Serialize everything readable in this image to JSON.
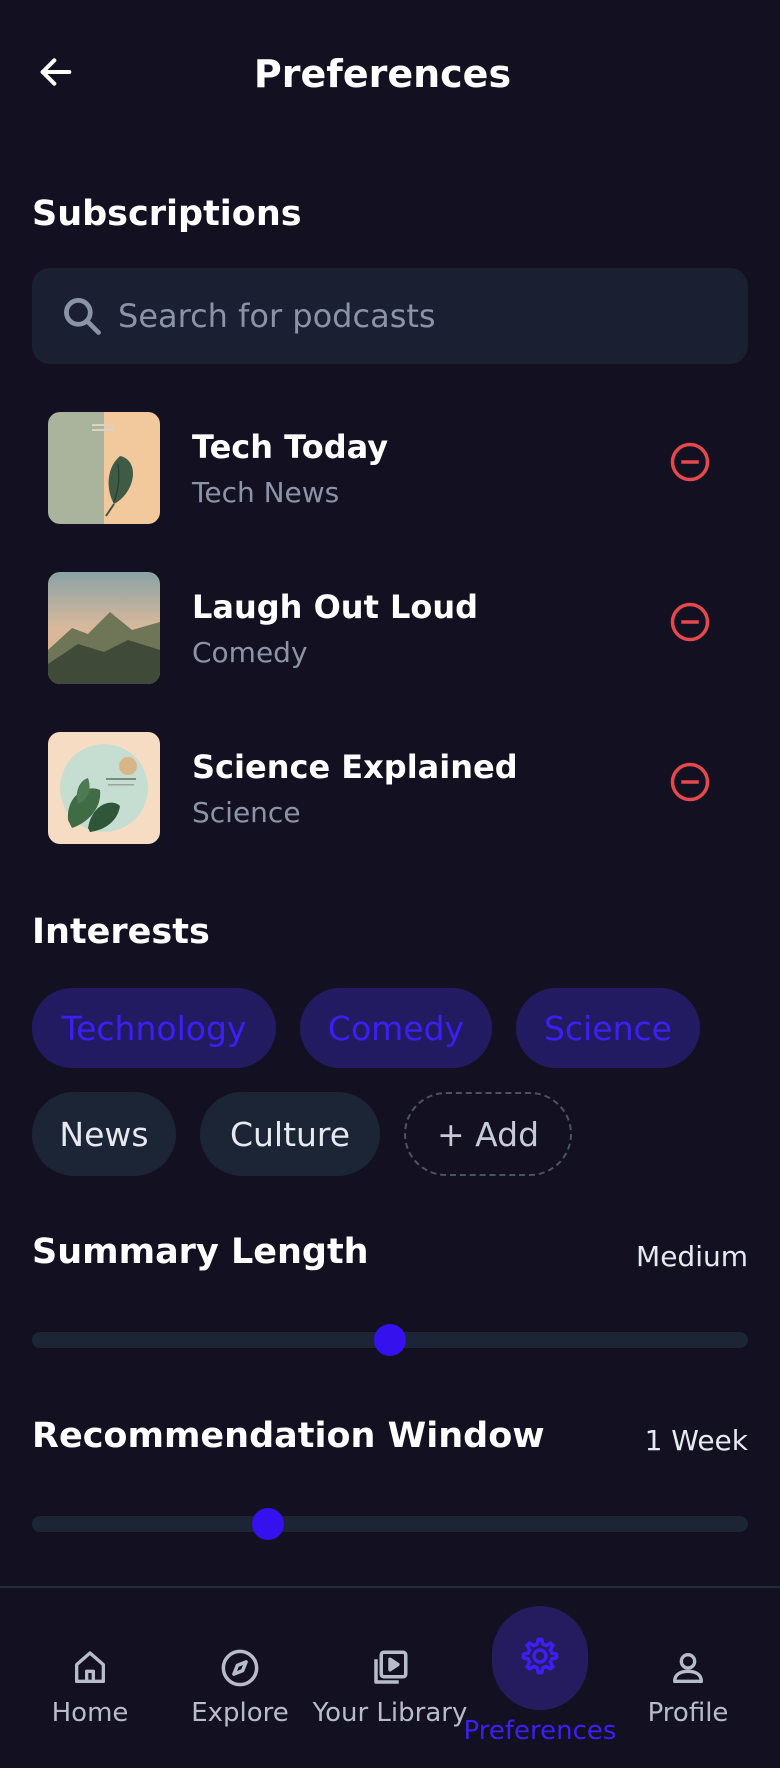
{
  "header": {
    "title": "Preferences",
    "back_icon": "arrow-left-icon"
  },
  "subscriptions": {
    "title": "Subscriptions",
    "search_placeholder": "Search for podcasts",
    "items": [
      {
        "name": "Tech Today",
        "category": "Tech News",
        "thumb": "leaf-cover"
      },
      {
        "name": "Laugh Out Loud",
        "category": "Comedy",
        "thumb": "mountain-cover"
      },
      {
        "name": "Science Explained",
        "category": "Science",
        "thumb": "plant-circle-cover"
      }
    ],
    "remove_icon": "minus-circle-icon",
    "remove_color": "#e5484d"
  },
  "interests": {
    "title": "Interests",
    "selected": [
      "Technology",
      "Comedy",
      "Science"
    ],
    "available": [
      "News",
      "Culture"
    ],
    "add_label": "+ Add"
  },
  "summary_length": {
    "label": "Summary Length",
    "value": "Medium",
    "level": 0.5
  },
  "recommendation_window": {
    "label": "Recommendation Window",
    "value": "1 Week",
    "level": 0.33
  },
  "nav": {
    "items": [
      {
        "label": "Home",
        "icon": "home-icon",
        "active": false
      },
      {
        "label": "Explore",
        "icon": "compass-icon",
        "active": false
      },
      {
        "label": "Your Library",
        "icon": "library-play-icon",
        "active": false
      },
      {
        "label": "Preferences",
        "icon": "gear-icon",
        "active": true
      },
      {
        "label": "Profile",
        "icon": "person-icon",
        "active": false
      }
    ]
  },
  "colors": {
    "background": "#131121",
    "accent": "#3511ee",
    "chip_selected_bg": "#231b62",
    "surface": "#1c2535"
  }
}
